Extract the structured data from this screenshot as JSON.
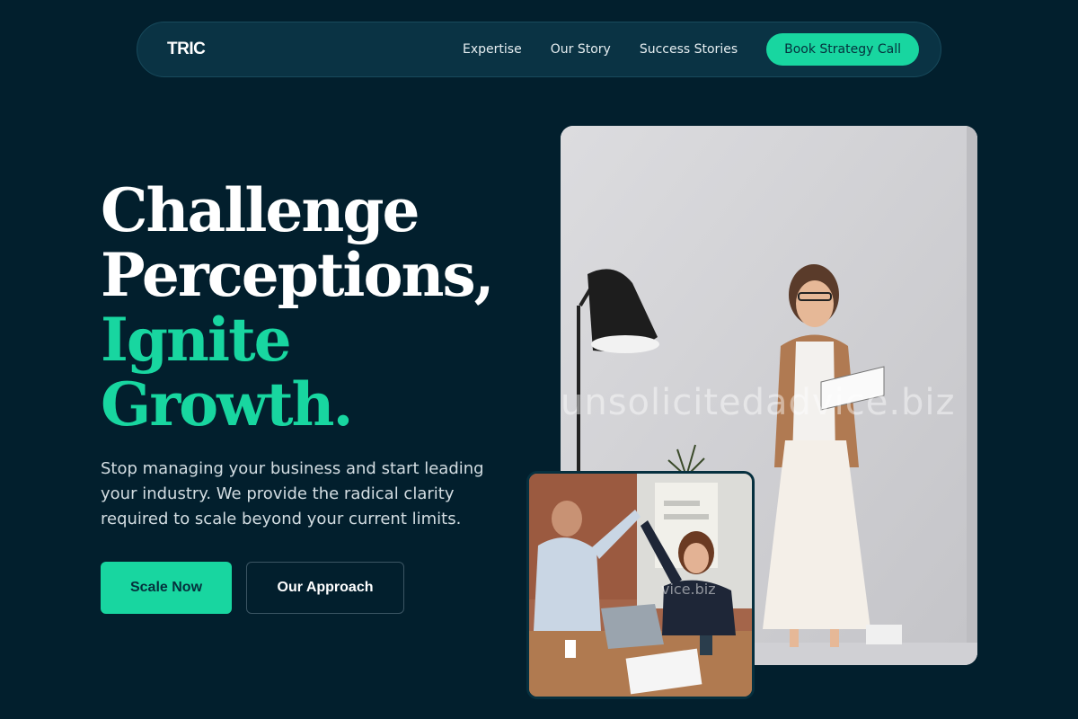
{
  "nav": {
    "logo": "TRIC",
    "links": [
      "Expertise",
      "Our Story",
      "Success Stories"
    ],
    "cta": "Book Strategy Call"
  },
  "hero": {
    "headline_line1": "Challenge",
    "headline_line2": "Perceptions,",
    "headline_line3": "Ignite",
    "headline_line4": "Growth.",
    "subtext": "Stop managing your business and start leading your industry. We provide the radical clarity required to scale beyond your current limits.",
    "primary_button": "Scale Now",
    "secondary_button": "Our Approach"
  },
  "images": {
    "main_watermark": "unsolicitedadvice.biz",
    "inset_watermark": "vice.biz"
  },
  "colors": {
    "background": "#021f2d",
    "accent": "#18d6a0",
    "nav_bg": "#0a3344"
  }
}
